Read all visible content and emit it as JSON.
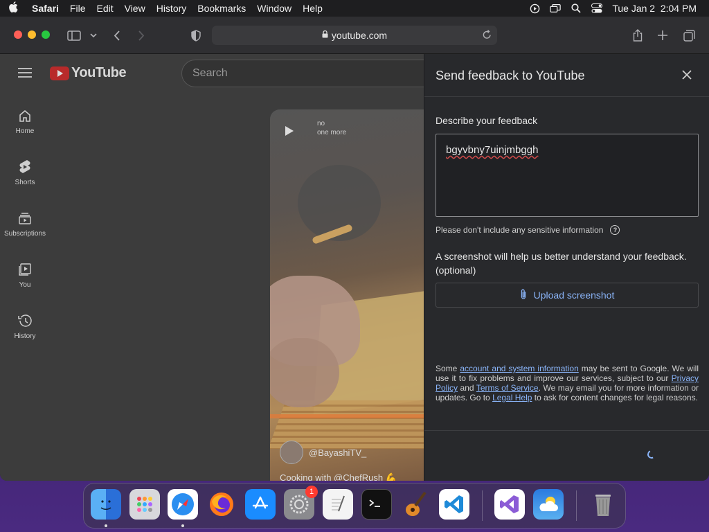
{
  "menubar": {
    "app": "Safari",
    "items": [
      "File",
      "Edit",
      "View",
      "History",
      "Bookmarks",
      "Window",
      "Help"
    ],
    "datetime": "Tue Jan 2  2:04 PM"
  },
  "browser": {
    "url": "youtube.com"
  },
  "youtube": {
    "logo_text": "YouTube",
    "search_placeholder": "Search",
    "nav": [
      {
        "label": "Home",
        "icon": "home-icon"
      },
      {
        "label": "Shorts",
        "icon": "shorts-icon"
      },
      {
        "label": "Subscriptions",
        "icon": "subscriptions-icon"
      },
      {
        "label": "You",
        "icon": "you-icon"
      },
      {
        "label": "History",
        "icon": "history-icon"
      }
    ],
    "short": {
      "meta_line1": "no",
      "meta_line2": "one more",
      "channel": "@BayashiTV_",
      "caption": "Cooking with @ChefRush 💪"
    }
  },
  "feedback": {
    "title": "Send feedback to YouTube",
    "describe_label": "Describe your feedback",
    "text_value": "bgyvbny7uinjmbggh",
    "sensitive_note": "Please don't include any sensitive information",
    "screenshot_label": "A screenshot will help us better understand your feedback. (optional)",
    "upload_label": "Upload screenshot",
    "legal": {
      "p1": "Some ",
      "link1": "account and system information",
      "p2": " may be sent to Google. We will use it to fix problems and improve our services, subject to our ",
      "link2": "Privacy Policy",
      "p3": " and ",
      "link3": "Terms of Service",
      "p4": ". We may email you for more information or updates. Go to ",
      "link4": "Legal Help",
      "p5": " to ask for content changes for legal reasons."
    }
  },
  "dock": {
    "apps": [
      "finder-icon",
      "launchpad-icon",
      "safari-icon",
      "firefox-icon",
      "app-store-icon",
      "system-settings-icon",
      "textedit-icon",
      "terminal-icon",
      "garageband-icon",
      "vscode-icon",
      "visual-studio-icon",
      "weather-icon",
      "trash-icon"
    ],
    "settings_badge": "1"
  }
}
